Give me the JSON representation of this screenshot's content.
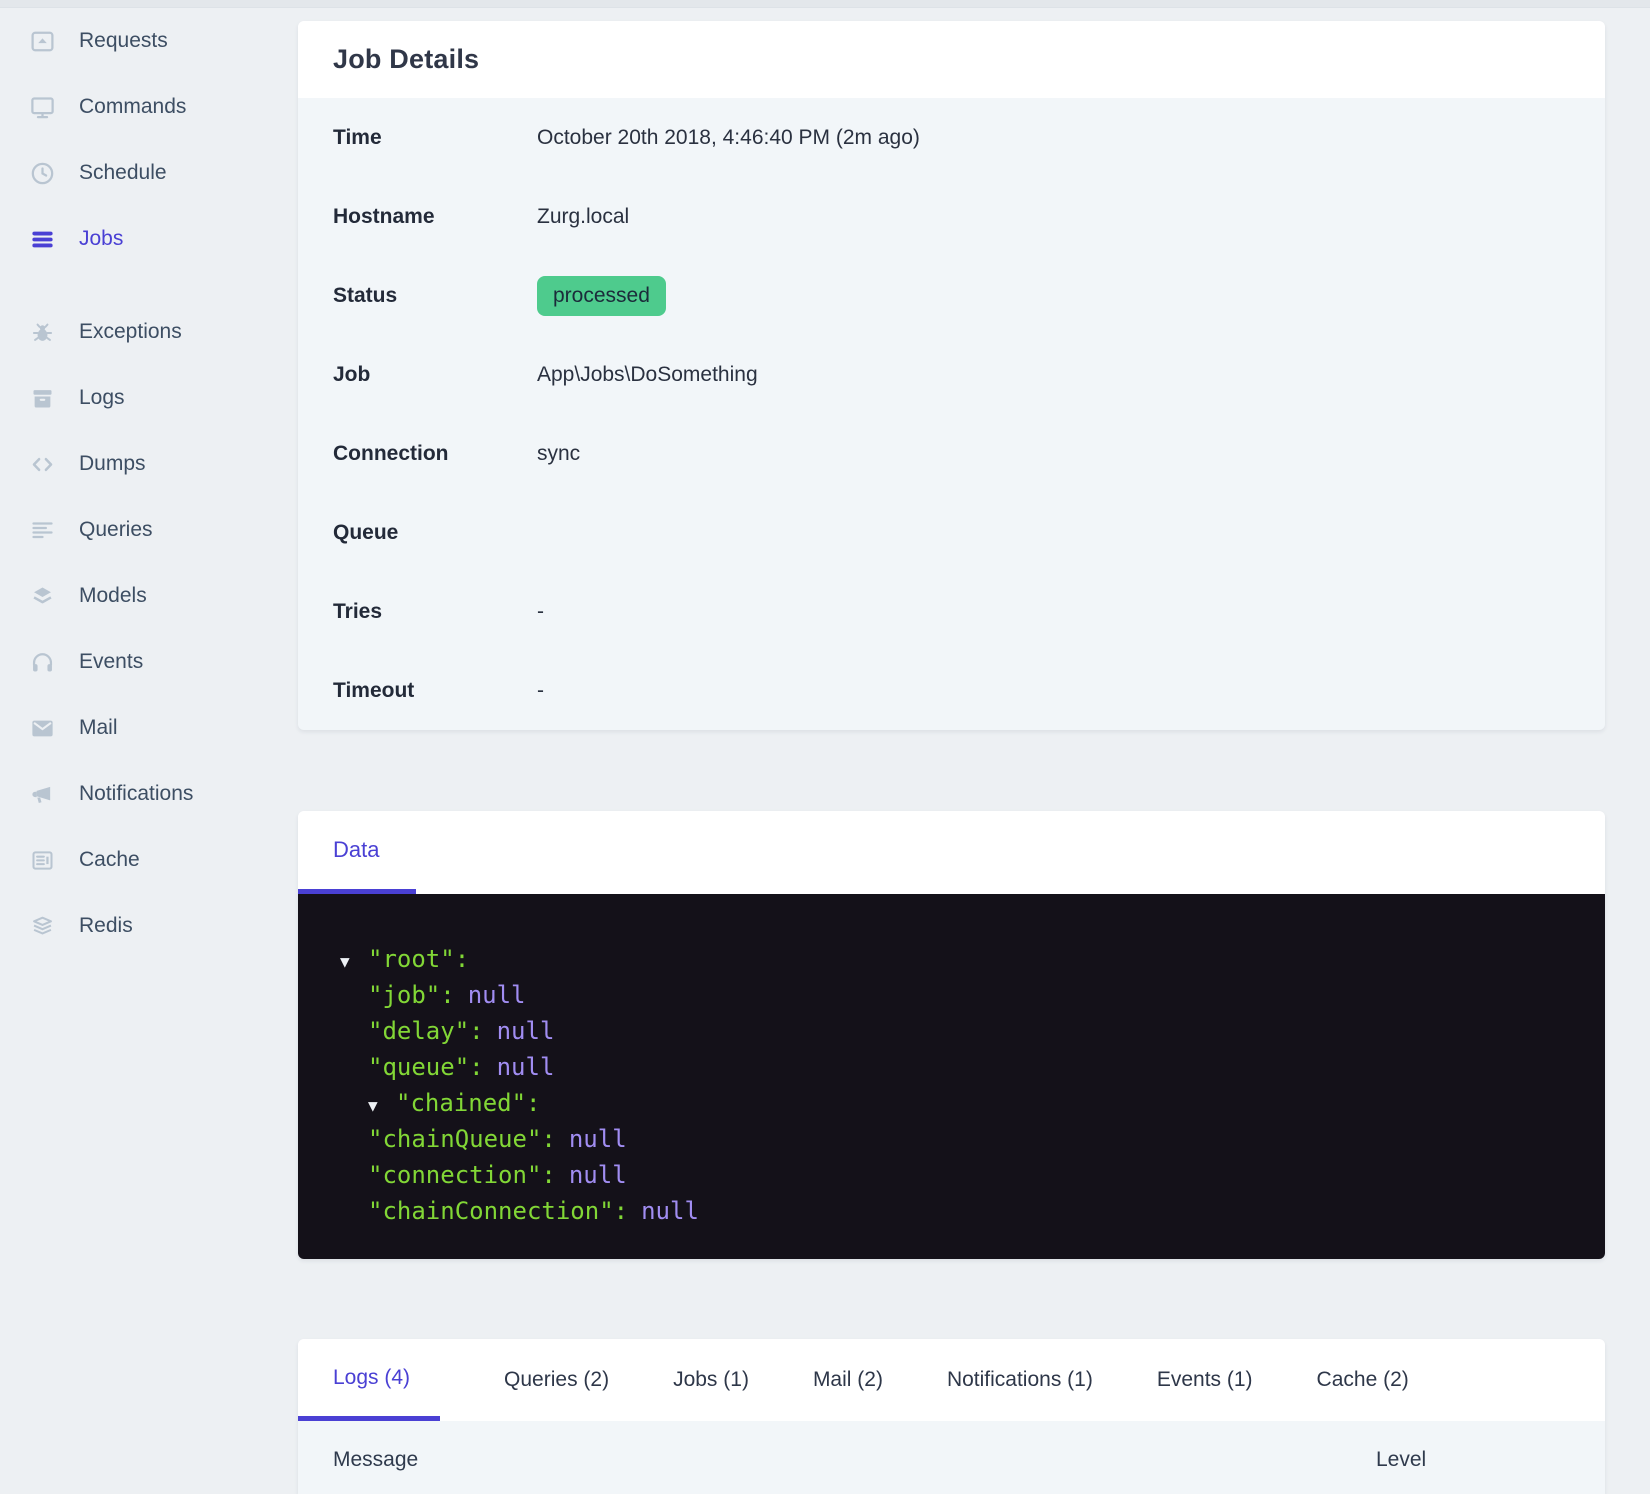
{
  "colors": {
    "accent": "#4a40d4",
    "badge_bg": "#4ecb8d",
    "badge_text": "#1b2b3a",
    "json_key": "#82d736",
    "json_null": "#a18df2",
    "panel_bg": "#141119"
  },
  "sidebar": {
    "items": [
      {
        "label": "Requests",
        "icon": "requests-icon"
      },
      {
        "label": "Commands",
        "icon": "commands-icon"
      },
      {
        "label": "Schedule",
        "icon": "schedule-icon"
      },
      {
        "label": "Jobs",
        "icon": "jobs-icon",
        "active": true
      },
      {
        "label": "Exceptions",
        "icon": "exceptions-icon",
        "group_start": true
      },
      {
        "label": "Logs",
        "icon": "logs-icon"
      },
      {
        "label": "Dumps",
        "icon": "dumps-icon"
      },
      {
        "label": "Queries",
        "icon": "queries-icon"
      },
      {
        "label": "Models",
        "icon": "models-icon"
      },
      {
        "label": "Events",
        "icon": "events-icon"
      },
      {
        "label": "Mail",
        "icon": "mail-icon"
      },
      {
        "label": "Notifications",
        "icon": "notifications-icon"
      },
      {
        "label": "Cache",
        "icon": "cache-icon"
      },
      {
        "label": "Redis",
        "icon": "redis-icon"
      }
    ]
  },
  "job_details": {
    "title": "Job Details",
    "rows": [
      {
        "label": "Time",
        "value": "October 20th 2018, 4:46:40 PM (2m ago)"
      },
      {
        "label": "Hostname",
        "value": "Zurg.local"
      },
      {
        "label": "Status",
        "value": "processed",
        "badge": true
      },
      {
        "label": "Job",
        "value": "App\\Jobs\\DoSomething"
      },
      {
        "label": "Connection",
        "value": "sync"
      },
      {
        "label": "Queue",
        "value": ""
      },
      {
        "label": "Tries",
        "value": "-"
      },
      {
        "label": "Timeout",
        "value": "-"
      }
    ]
  },
  "data_panel": {
    "tab_label": "Data",
    "json_lines": [
      {
        "indent": 0,
        "expander": true,
        "key": "root"
      },
      {
        "indent": 1,
        "key": "job",
        "value": "null"
      },
      {
        "indent": 1,
        "key": "delay",
        "value": "null"
      },
      {
        "indent": 1,
        "key": "queue",
        "value": "null"
      },
      {
        "indent": 1,
        "expander": true,
        "key": "chained"
      },
      {
        "indent": 1,
        "key": "chainQueue",
        "value": "null"
      },
      {
        "indent": 1,
        "key": "connection",
        "value": "null"
      },
      {
        "indent": 1,
        "key": "chainConnection",
        "value": "null"
      }
    ]
  },
  "related_tabs": {
    "tabs": [
      {
        "label": "Logs (4)",
        "active": true
      },
      {
        "label": "Queries (2)"
      },
      {
        "label": "Jobs (1)"
      },
      {
        "label": "Mail (2)"
      },
      {
        "label": "Notifications (1)"
      },
      {
        "label": "Events (1)"
      },
      {
        "label": "Cache (2)"
      }
    ],
    "columns": [
      "Message",
      "Level"
    ]
  }
}
